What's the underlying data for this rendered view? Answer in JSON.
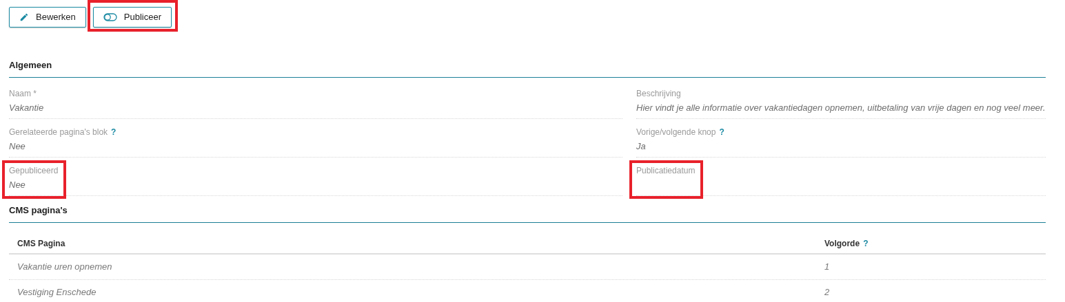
{
  "toolbar": [
    {
      "kind": "edit",
      "label": "Bewerken",
      "highlighted": false
    },
    {
      "kind": "publish",
      "label": "Publiceer",
      "highlighted": true
    }
  ],
  "sections": [
    {
      "title": "Algemeen",
      "fields": [
        {
          "label": "Naam *",
          "value": "Vakantie",
          "highlighted": false
        },
        {
          "label": "Beschrijving",
          "value": "Hier vindt je alle informatie over vakantiedagen opnemen, uitbetaling van vrije dagen en nog veel meer.",
          "highlighted": false
        },
        {
          "label": "Gerelateerde pagina's blok",
          "help": "?",
          "value": "Nee",
          "highlighted": false
        },
        {
          "label": "Vorige/volgende knop",
          "help": "?",
          "value": "Ja",
          "highlighted": false
        },
        {
          "label": "Gepubliceerd",
          "value": "Nee",
          "highlighted": true
        },
        {
          "label": "Publicatiedatum",
          "highlighted": true
        }
      ]
    },
    {
      "title": "CMS pagina's",
      "table": {
        "columns": [
          {
            "label": "CMS Pagina"
          },
          {
            "label": "Volgorde",
            "help": "?"
          }
        ],
        "rows": [
          [
            "Vakantie uren opnemen",
            "1"
          ],
          [
            "Vestiging Enschede",
            "2"
          ]
        ]
      }
    }
  ]
}
